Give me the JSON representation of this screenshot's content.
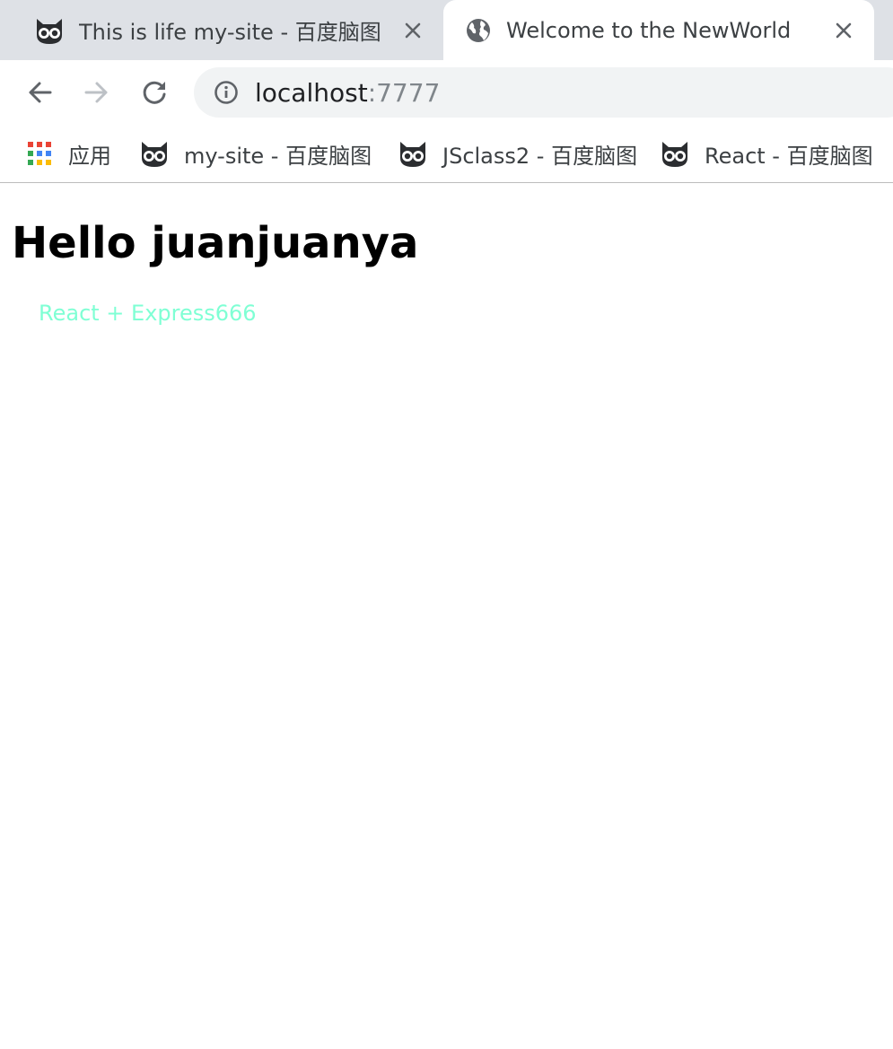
{
  "browser": {
    "tabs": [
      {
        "title": "This is life my-site - 百度脑图",
        "icon": "owl-icon",
        "active": false
      },
      {
        "title": "Welcome to the NewWorld",
        "icon": "globe-icon",
        "active": true
      }
    ],
    "address": {
      "host": "localhost",
      "port": ":7777"
    },
    "bookmarks": [
      {
        "label": "应用",
        "icon": "apps-grid-icon"
      },
      {
        "label": "my-site - 百度脑图",
        "icon": "owl-icon"
      },
      {
        "label": "JSclass2 - 百度脑图",
        "icon": "owl-icon"
      },
      {
        "label": "React - 百度脑图",
        "icon": "owl-icon"
      }
    ]
  },
  "page": {
    "heading": "Hello juanjuanya",
    "subtitle": "React + Express666",
    "subtitle_color": "#7fffd4"
  },
  "colors": {
    "tabstrip": "#dee1e6",
    "omnibox": "#f1f3f4",
    "text": "#3c4043",
    "port": "#80868b"
  }
}
